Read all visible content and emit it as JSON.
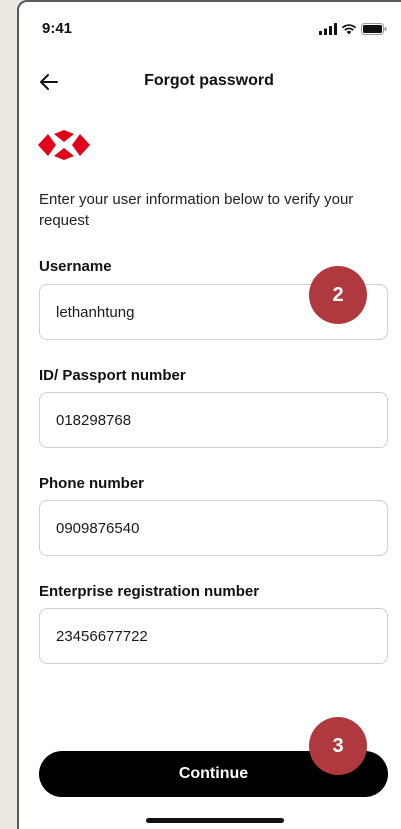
{
  "status_bar": {
    "time": "9:41"
  },
  "header": {
    "title": "Forgot password"
  },
  "intro_text": "Enter your user information below to verify your request",
  "fields": [
    {
      "label": "Username",
      "value": "lethanhtung"
    },
    {
      "label": "ID/ Passport number",
      "value": "018298768"
    },
    {
      "label": "Phone number",
      "value": "0909876540"
    },
    {
      "label": "Enterprise registration number",
      "value": "23456677722"
    }
  ],
  "badges": {
    "step_2": "2",
    "step_3": "3"
  },
  "continue_button": {
    "label": "Continue"
  },
  "colors": {
    "brand_red": "#e3001b",
    "badge_red": "#b0393f",
    "button_black": "#000000"
  },
  "icons": {
    "back": "arrow-left-icon",
    "signal": "signal-icon",
    "wifi": "wifi-icon",
    "battery": "battery-icon",
    "logo": "brand-logo-icon"
  }
}
